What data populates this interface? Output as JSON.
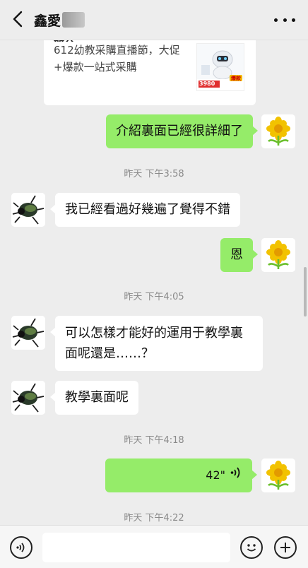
{
  "header": {
    "title": "鑫愛"
  },
  "card": {
    "cut_line": "器人",
    "line1": "612幼教采購直播節，大促",
    "line2": "+爆款一站式采購",
    "thumb_price": "3980",
    "thumb_badge": "爆款"
  },
  "messages": [
    {
      "from": "me",
      "text": "介紹裏面已經很詳細了"
    },
    {
      "type": "time",
      "text": "昨天 下午3:58"
    },
    {
      "from": "them",
      "text": "我已經看過好幾遍了覺得不錯"
    },
    {
      "from": "me",
      "text": "恩"
    },
    {
      "type": "time",
      "text": "昨天 下午4:05"
    },
    {
      "from": "them",
      "text": "可以怎樣才能好的運用于教學裏面呢還是……？"
    },
    {
      "from": "them",
      "text": "教學裏面呢"
    },
    {
      "type": "time",
      "text": "昨天 下午4:18"
    },
    {
      "from": "me",
      "type": "voice",
      "text": "42\""
    },
    {
      "type": "time",
      "text": "昨天 下午4:22"
    }
  ],
  "icons": {
    "back": "chevron-left-icon",
    "more": "more-dots-icon",
    "voice_toggle": "voice-icon",
    "emoji": "emoji-icon",
    "add": "plus-icon"
  },
  "colors": {
    "my_bubble": "#95ec69",
    "their_bubble": "#ffffff",
    "background": "#ededed"
  }
}
